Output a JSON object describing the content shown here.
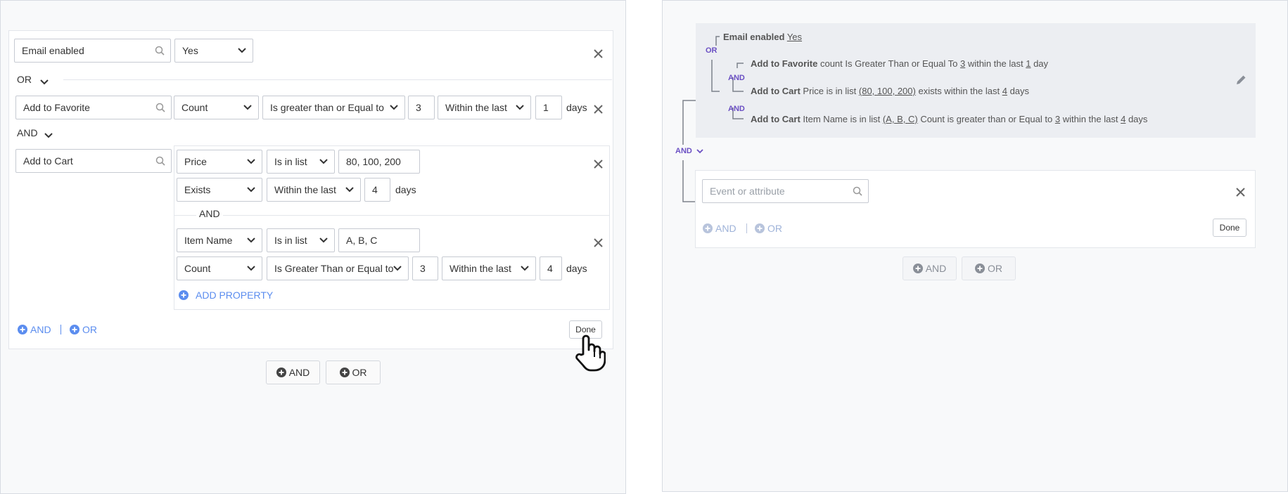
{
  "colors": {
    "accent_blue": "#5b8def",
    "purple": "#6a4fc3",
    "panel_bg": "#f8f9fa",
    "summary_bg": "#eceef2"
  },
  "left": {
    "row1": {
      "event": "Email enabled",
      "value": "Yes"
    },
    "or_label": "OR",
    "row2": {
      "event": "Add to Favorite",
      "aggregate": "Count",
      "operator": "Is greater than or Equal to",
      "number": "3",
      "time": "Within the last",
      "days_value": "1",
      "days_label": "days"
    },
    "and_label": "AND",
    "row3": {
      "event": "Add to Cart",
      "prop1": {
        "name": "Price",
        "operator": "Is in list",
        "value": "80, 100, 200"
      },
      "prop1_time": {
        "aggregate": "Exists",
        "time": "Within the last",
        "days_value": "4",
        "days_label": "days"
      },
      "inner_and": "AND",
      "prop2": {
        "name": "Item Name",
        "operator": "Is in list",
        "value": "A, B, C"
      },
      "prop2_time": {
        "aggregate": "Count",
        "operator": "Is Greater Than or Equal to",
        "number": "3",
        "time": "Within the last",
        "days_value": "4",
        "days_label": "days"
      },
      "add_property": "ADD PROPERTY"
    },
    "footer": {
      "and": "AND",
      "or": "OR",
      "done": "Done"
    },
    "bottom": {
      "and": "AND",
      "or": "OR"
    }
  },
  "right": {
    "summary": {
      "line1": {
        "event": "Email enabled",
        "value": "Yes"
      },
      "or": "OR",
      "line2": {
        "event": "Add to Favorite",
        "t1": "count Is Greater Than or Equal To",
        "n": "3",
        "t2": "within the last",
        "d": "1",
        "t3": "day"
      },
      "and1": "AND",
      "line3": {
        "event": "Add to Cart",
        "t1": "Price is in list",
        "list": "(80, 100, 200)",
        "t2": "exists within the last",
        "d": "4",
        "t3": "days"
      },
      "and2": "AND",
      "line4": {
        "event": "Add to Cart",
        "t1": "Item Name is in list",
        "list": "(A, B, C)",
        "t2": "Count is greater than or Equal to",
        "n": "3",
        "t3": "within the last",
        "d": "4",
        "t4": "days"
      }
    },
    "and_connector": "AND",
    "new_rule": {
      "placeholder": "Event or attribute",
      "and": "AND",
      "or": "OR",
      "done": "Done"
    },
    "bottom": {
      "and": "AND",
      "or": "OR"
    }
  }
}
